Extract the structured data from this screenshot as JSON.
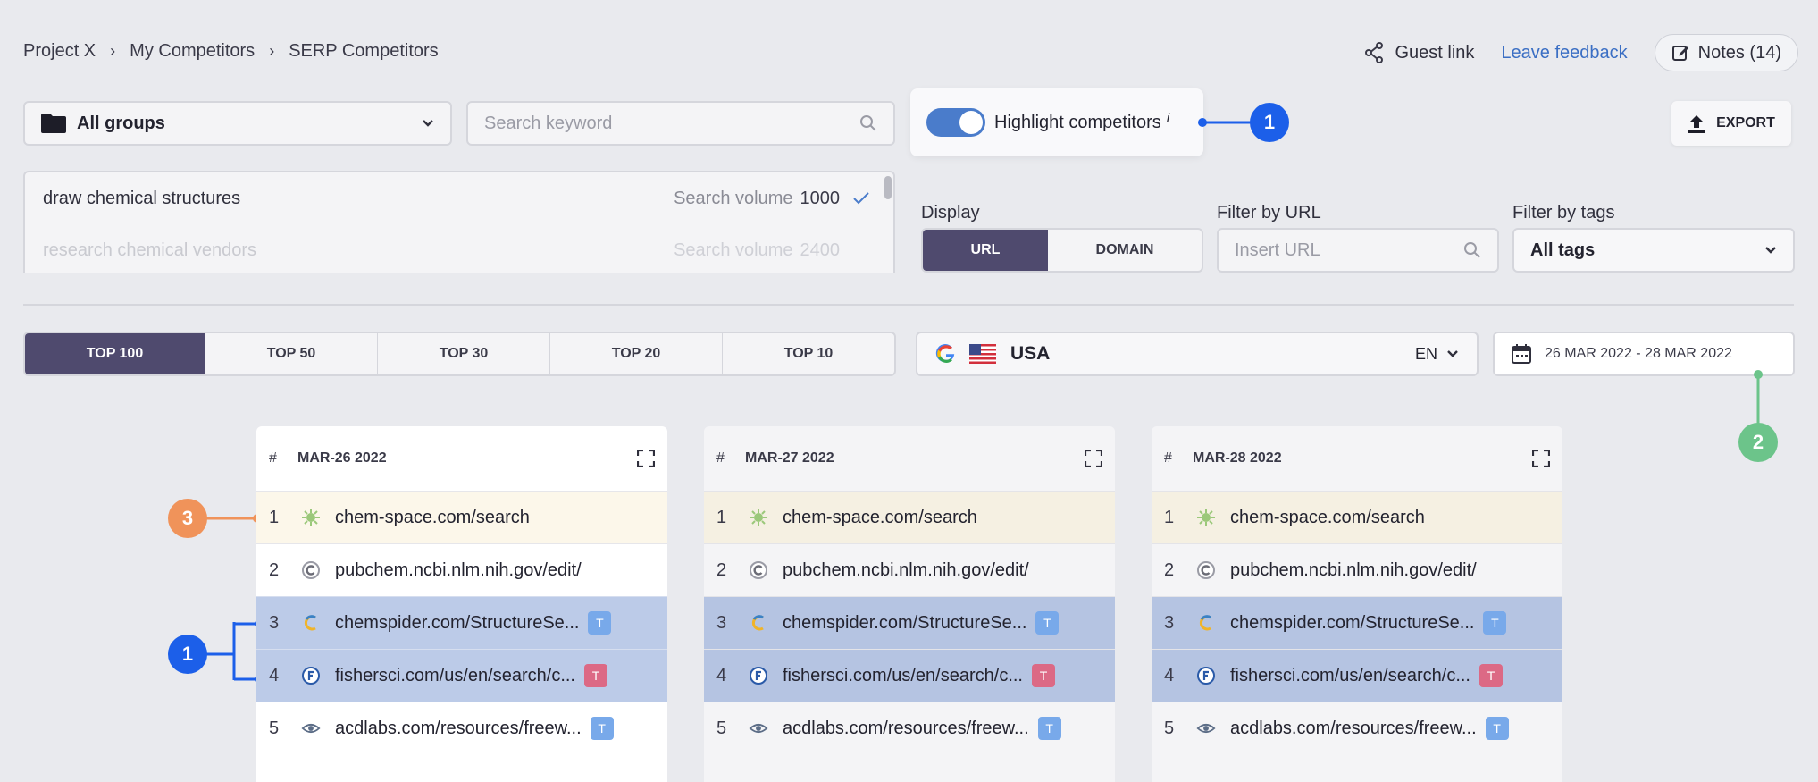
{
  "breadcrumb": [
    "Project X",
    "My Competitors",
    "SERP Competitors"
  ],
  "header": {
    "guest_link": "Guest link",
    "leave_feedback": "Leave feedback",
    "notes": "Notes (14)"
  },
  "filters": {
    "group": "All groups",
    "search_placeholder": "Search keyword",
    "highlight_label": "Highlight competitors",
    "highlight_info": "i",
    "export": "EXPORT"
  },
  "keywords": [
    {
      "text": "draw chemical structures",
      "vol_label": "Search volume",
      "vol": "1000",
      "checked": true
    },
    {
      "text": "research chemical vendors",
      "vol_label": "Search volume",
      "vol": "2400",
      "checked": false
    }
  ],
  "display": {
    "label": "Display",
    "options": [
      "URL",
      "DOMAIN"
    ],
    "active": "URL"
  },
  "filter_url": {
    "label": "Filter by URL",
    "placeholder": "Insert URL"
  },
  "filter_tags": {
    "label": "Filter by tags",
    "value": "All tags"
  },
  "tops": [
    "TOP 100",
    "TOP 50",
    "TOP 30",
    "TOP 20",
    "TOP 10"
  ],
  "region": {
    "country": "USA",
    "lang": "EN"
  },
  "date_range": "26 MAR 2022 - 28 MAR 2022",
  "callouts": {
    "one": "1",
    "two": "2",
    "three": "3",
    "one_b": "1"
  },
  "columns": [
    {
      "hash": "#",
      "date": "MAR-26 2022"
    },
    {
      "hash": "#",
      "date": "MAR-27 2022"
    },
    {
      "hash": "#",
      "date": "MAR-28 2022"
    }
  ],
  "rows": [
    {
      "pos": "1",
      "url": "chem-space.com/search",
      "icon": "virus-icon",
      "tag": null
    },
    {
      "pos": "2",
      "url": "pubchem.ncbi.nlm.nih.gov/edit/",
      "icon": "c-circle-icon",
      "tag": null
    },
    {
      "pos": "3",
      "url": "chemspider.com/StructureSe...",
      "icon": "chemspider-icon",
      "tag": "T",
      "tag_color": "blue"
    },
    {
      "pos": "4",
      "url": "fishersci.com/us/en/search/c...",
      "icon": "fisher-icon",
      "tag": "T",
      "tag_color": "red"
    },
    {
      "pos": "5",
      "url": "acdlabs.com/resources/freew...",
      "icon": "eye-icon",
      "tag": "T",
      "tag_color": "blue"
    }
  ],
  "colors": {
    "accent": "#4f4a6e",
    "callout_blue": "#1c5fe9",
    "callout_green": "#6cc48a",
    "callout_orange": "#f0935a",
    "highlight_row": "#bccbe8"
  }
}
